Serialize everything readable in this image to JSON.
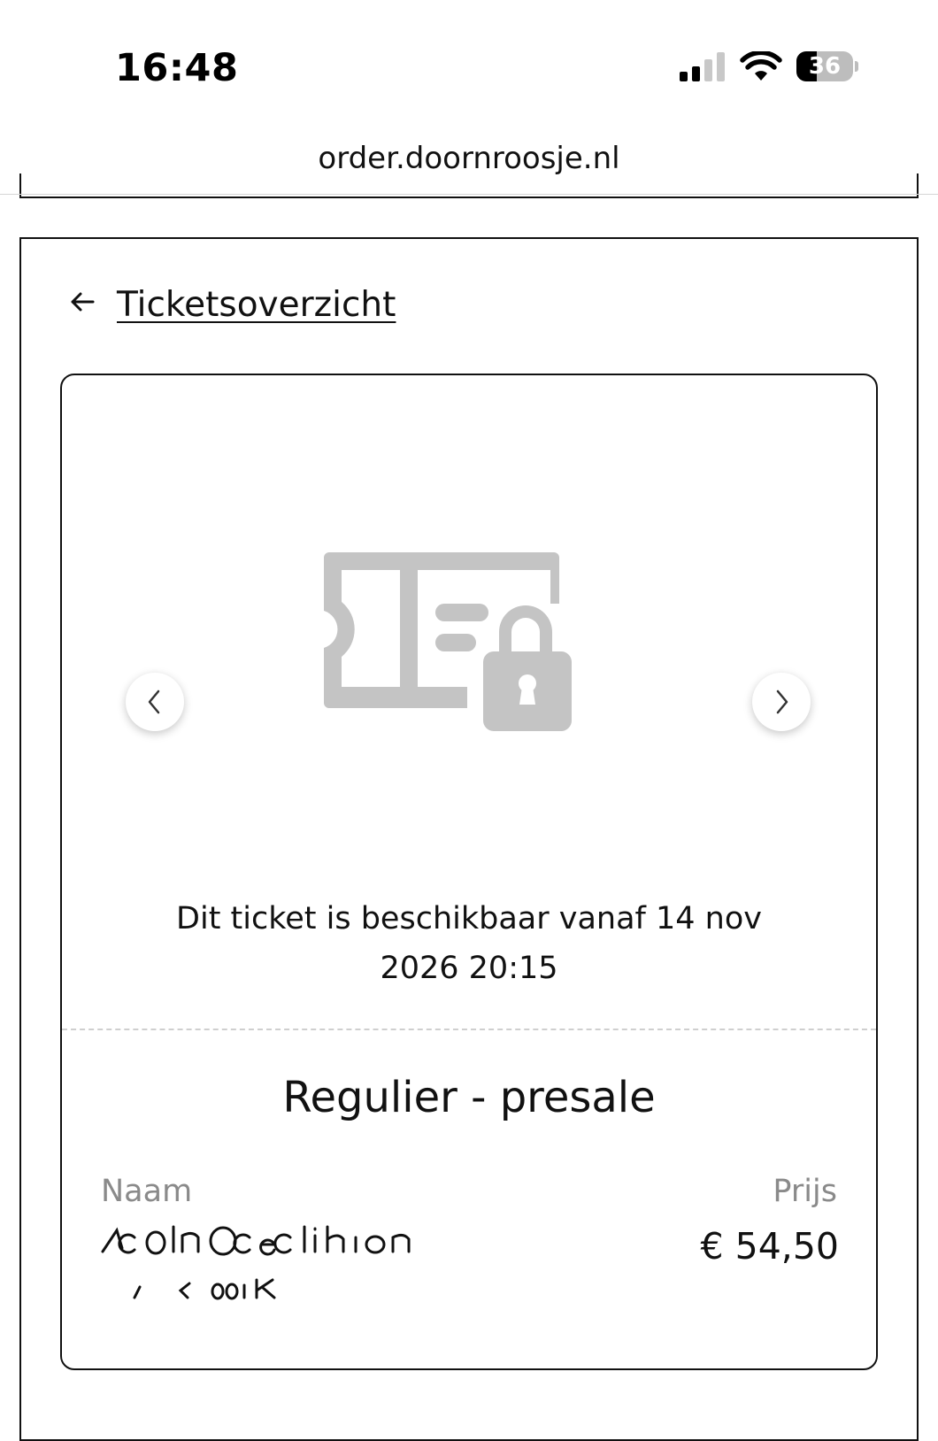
{
  "status_bar": {
    "time": "16:48",
    "battery_level": "36",
    "battery_fraction": 0.36,
    "signal_bars_active": 2,
    "signal_bars_total": 4
  },
  "browser": {
    "url": "order.doornroosje.nl"
  },
  "nav": {
    "back_label": "Ticketsoverzicht"
  },
  "ticket": {
    "icon": "ticket-locked-icon",
    "availability_line1": "Dit ticket is beschikbaar vanaf 14 nov",
    "availability_line2": "2026 20:15",
    "type": "Regulier - presale",
    "name_label": "Naam",
    "price_label": "Prijs",
    "price": "€ 54,50",
    "holder_name_redacted": true
  },
  "colors": {
    "text": "#111111",
    "muted": "#8a8a8a",
    "icon_gray": "#c4c4c4",
    "divider": "#cfcfcf"
  }
}
